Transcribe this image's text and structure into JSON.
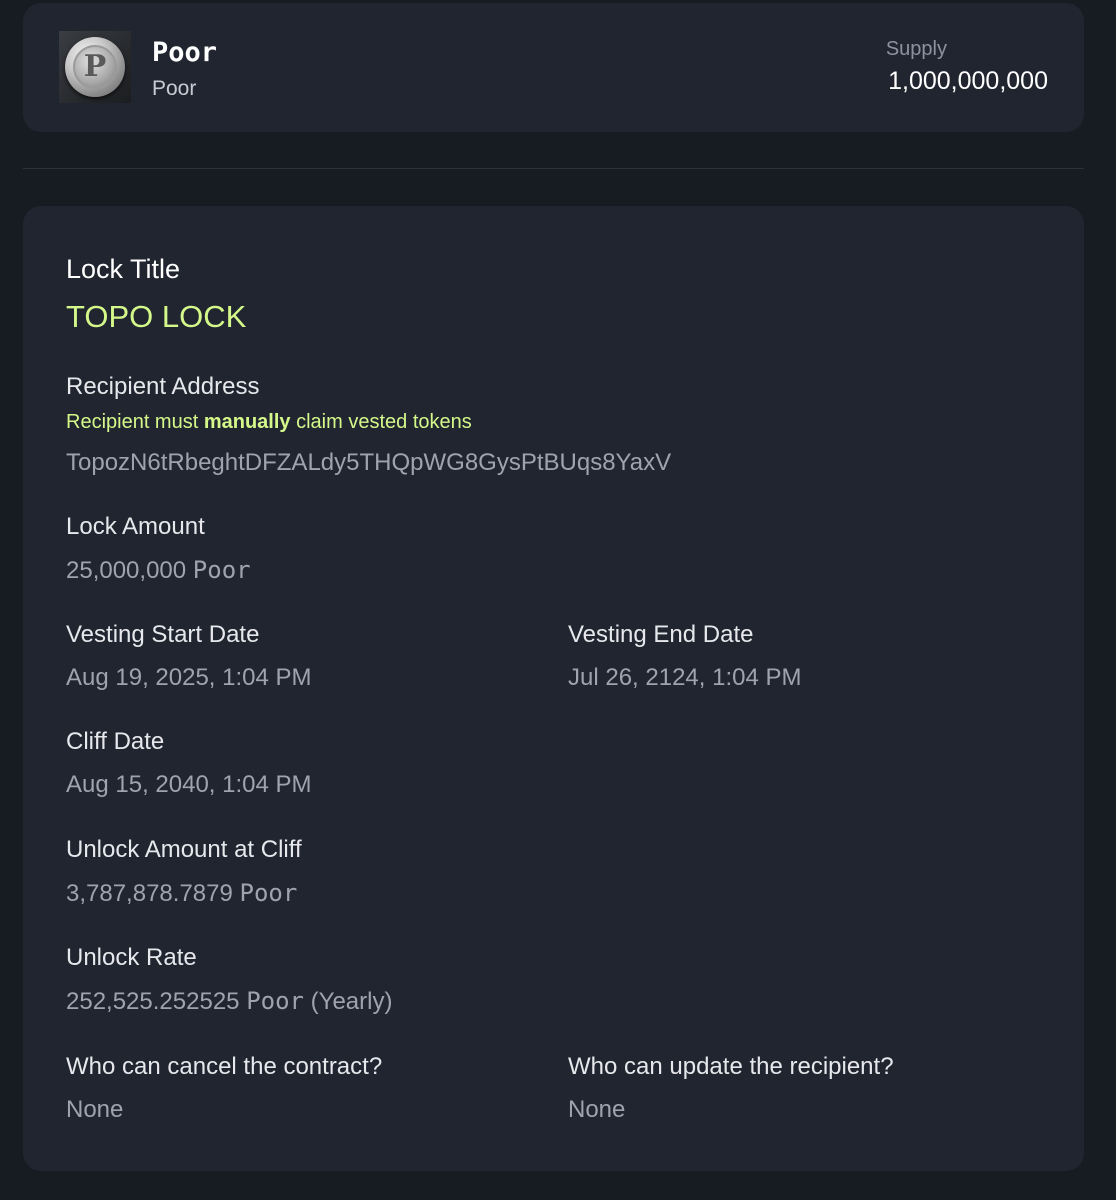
{
  "token": {
    "name": "Poor",
    "symbol": "Poor",
    "logo_icon": "coin-p-icon",
    "supply_label": "Supply",
    "supply_value": "1,000,000,000"
  },
  "lock": {
    "title_label": "Lock Title",
    "title_value": "TOPO LOCK",
    "recipient_label": "Recipient Address",
    "recipient_note_prefix": "Recipient must",
    "recipient_note_bold": "manually",
    "recipient_note_suffix": "claim vested tokens",
    "recipient_address": "TopozN6tRbeghtDFZALdy5THQpWG8GysPtBUqs8YaxV",
    "amount_label": "Lock Amount",
    "amount_value": "25,000,000",
    "amount_unit": "Poor",
    "start_label": "Vesting Start Date",
    "start_value": "Aug 19, 2025, 1:04 PM",
    "end_label": "Vesting End Date",
    "end_value": "Jul 26, 2124, 1:04 PM",
    "cliff_label": "Cliff Date",
    "cliff_value": "Aug 15, 2040, 1:04 PM",
    "cliff_amount_label": "Unlock Amount at Cliff",
    "cliff_amount_value": "3,787,878.7879",
    "cliff_amount_unit": "Poor",
    "rate_label": "Unlock Rate",
    "rate_value": "252,525.252525",
    "rate_unit": "Poor",
    "rate_period": "(Yearly)",
    "cancel_label": "Who can cancel the contract?",
    "cancel_value": "None",
    "update_label": "Who can update the recipient?",
    "update_value": "None"
  },
  "colors": {
    "background": "#171b22",
    "card": "#212530",
    "accent": "#d4f88a"
  }
}
